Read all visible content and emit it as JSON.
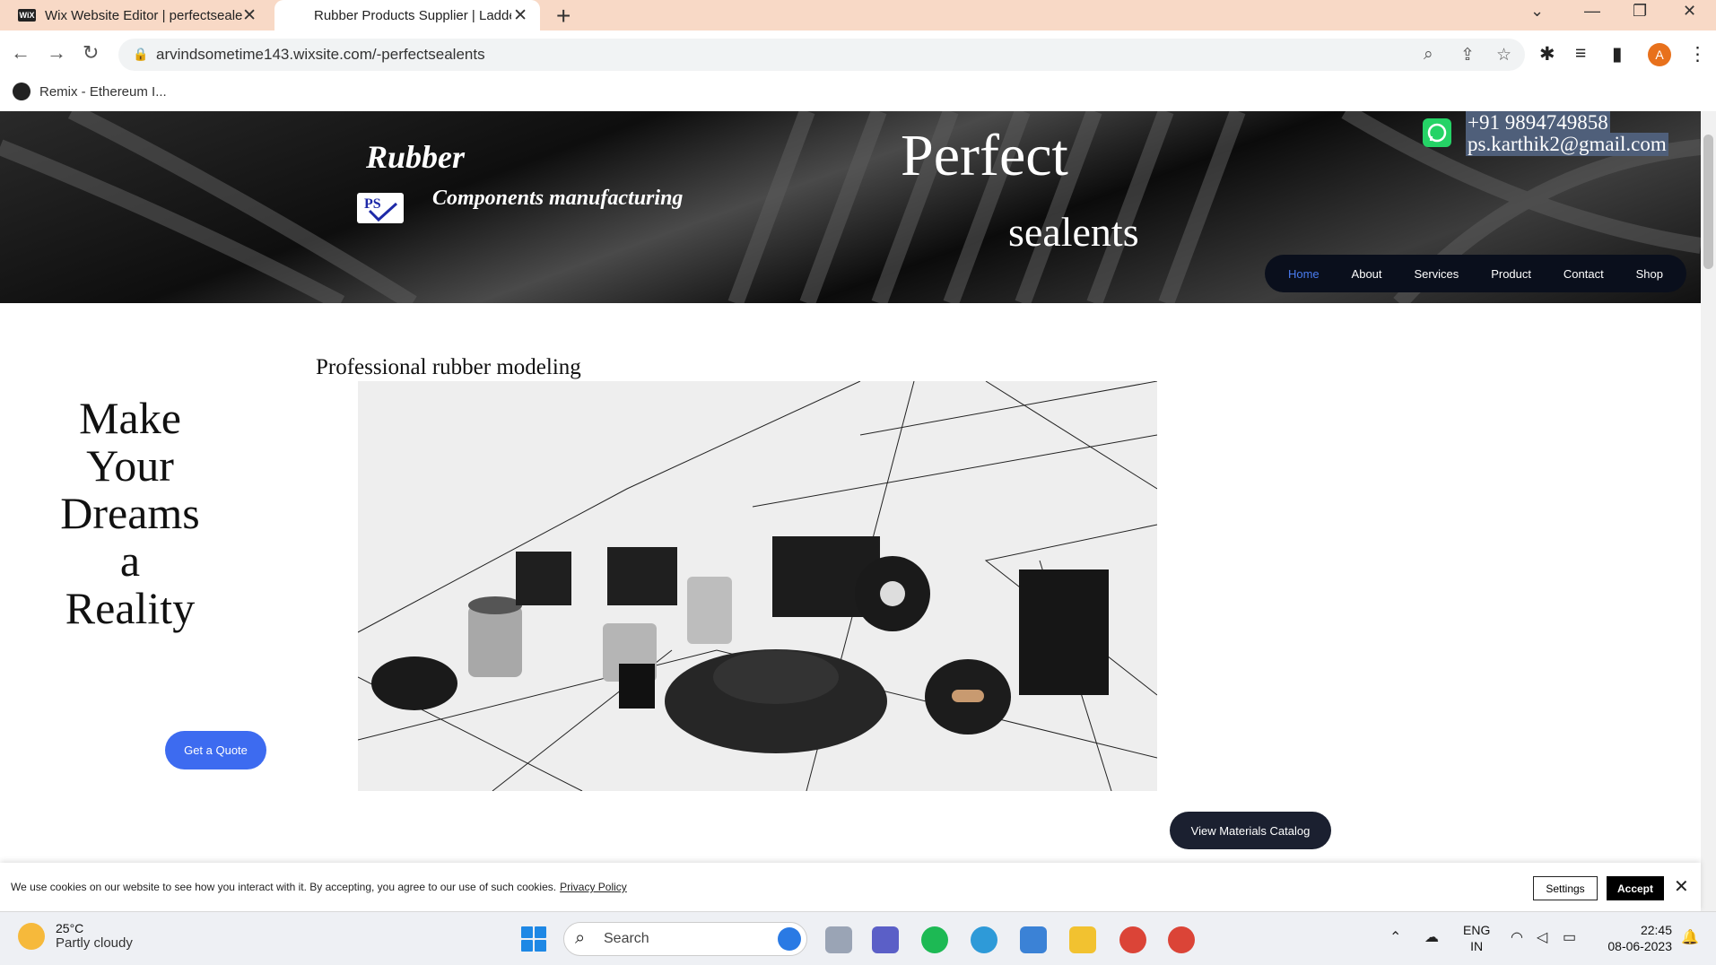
{
  "browser": {
    "tabs": [
      {
        "favicon": "WiX",
        "title": "Wix Website Editor | perfectseale"
      },
      {
        "title": "Rubber Products Supplier | Ladde"
      }
    ],
    "new_tab": "+",
    "window_controls": [
      "chevron-down-icon",
      "minimize-icon",
      "restore-icon",
      "close-icon"
    ],
    "url": "arvindsometime143.wixsite.com/-perfectsealents",
    "profile_initial": "A",
    "bookmark": "Remix - Ethereum I..."
  },
  "hero": {
    "rubber": "Rubber",
    "logo_text": "PS",
    "components": "Components manufacturing",
    "perfect": "Perfect",
    "sealents": "sealents",
    "phone": "+91 9894749858",
    "email": "ps.karthik2@gmail.com"
  },
  "nav": {
    "items": [
      "Home",
      "About",
      "Services",
      "Product",
      "Contact",
      "Shop"
    ],
    "active": "Home",
    "active_color": "#4a7cf0"
  },
  "main": {
    "heading": "Professional rubber modeling",
    "tagline": [
      "Make",
      "Your",
      "Dreams",
      "a",
      "Reality"
    ],
    "quote_button": "Get a Quote",
    "catalog_button": "View Materials Catalog"
  },
  "cookie": {
    "message": "We use cookies on our website to see how you interact with it. By accepting, you agree to our use of such cookies.",
    "policy_link": "Privacy Policy",
    "settings": "Settings",
    "accept": "Accept"
  },
  "taskbar": {
    "temperature": "25°C",
    "condition": "Partly cloudy",
    "search_placeholder": "Search",
    "lang_top": "ENG",
    "lang_bottom": "IN",
    "time": "22:45",
    "date": "08-06-2023"
  },
  "colors": {
    "tabbar": "#f8d9c6",
    "accent_button": "#3d6bf0",
    "nav_bg": "#0a0f1c",
    "catalog_btn": "#1b2030"
  }
}
